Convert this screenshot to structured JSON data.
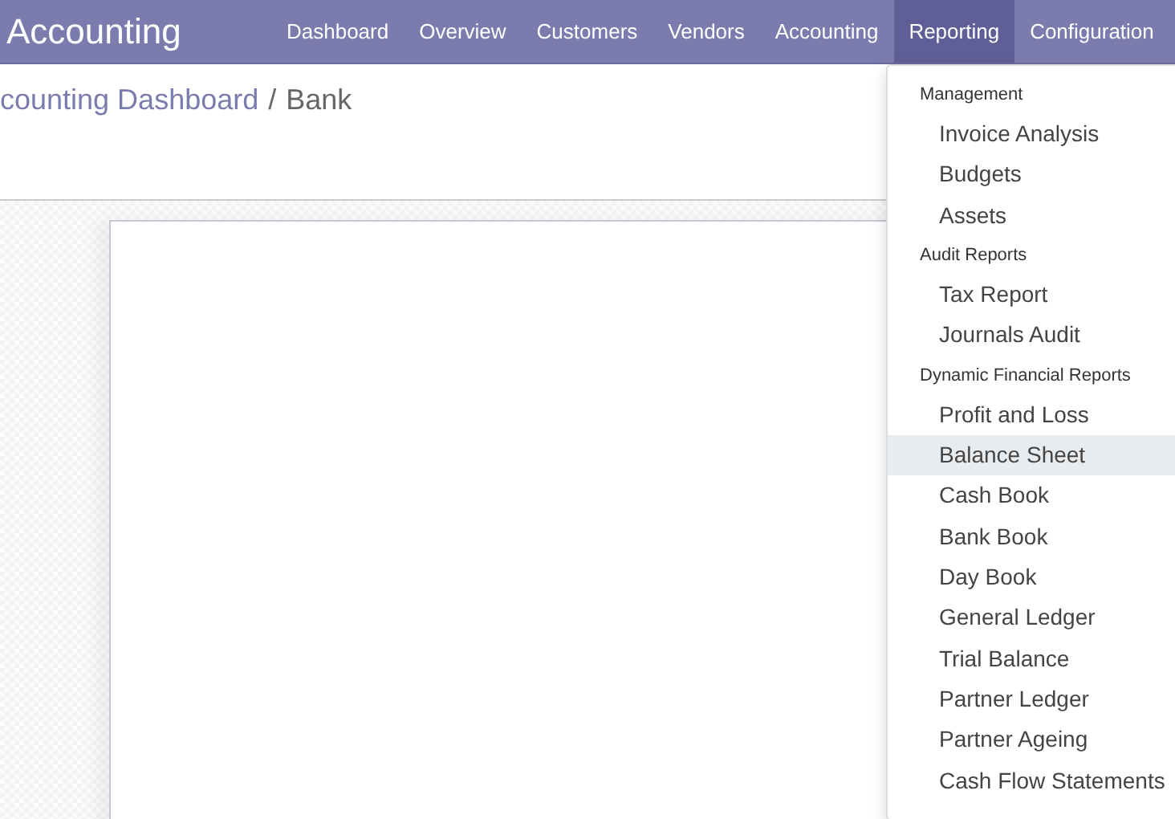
{
  "navbar": {
    "brand": "Accounting",
    "menu": [
      {
        "label": "Dashboard",
        "selected": false
      },
      {
        "label": "Overview",
        "selected": false
      },
      {
        "label": "Customers",
        "selected": false
      },
      {
        "label": "Vendors",
        "selected": false
      },
      {
        "label": "Accounting",
        "selected": false
      },
      {
        "label": "Reporting",
        "selected": true
      },
      {
        "label": "Configuration",
        "selected": false
      }
    ]
  },
  "breadcrumb": [
    {
      "label": "counting Dashboard",
      "kind": "link"
    },
    {
      "label": "/",
      "kind": "separator"
    },
    {
      "label": "Bank",
      "kind": "current"
    }
  ],
  "dropdown": {
    "sections": [
      {
        "header": "Management",
        "items": [
          {
            "label": "Invoice Analysis",
            "selected": false
          },
          {
            "label": "Budgets",
            "selected": false
          },
          {
            "label": "Assets",
            "selected": false
          }
        ]
      },
      {
        "header": "Audit Reports",
        "items": [
          {
            "label": "Tax Report",
            "selected": false
          },
          {
            "label": "Journals Audit",
            "selected": false
          }
        ]
      },
      {
        "header": "Dynamic Financial Reports",
        "items": [
          {
            "label": "Profit and Loss",
            "selected": false
          },
          {
            "label": "Balance Sheet",
            "selected": true
          },
          {
            "label": "Cash Book",
            "selected": false
          },
          {
            "label": "Bank Book",
            "selected": false
          },
          {
            "label": "Day Book",
            "selected": false
          },
          {
            "label": "General Ledger",
            "selected": false
          },
          {
            "label": "Trial Balance",
            "selected": false
          },
          {
            "label": "Partner Ledger",
            "selected": false
          },
          {
            "label": "Partner Ageing",
            "selected": false
          },
          {
            "label": "Cash Flow Statements",
            "selected": false
          }
        ]
      }
    ]
  }
}
